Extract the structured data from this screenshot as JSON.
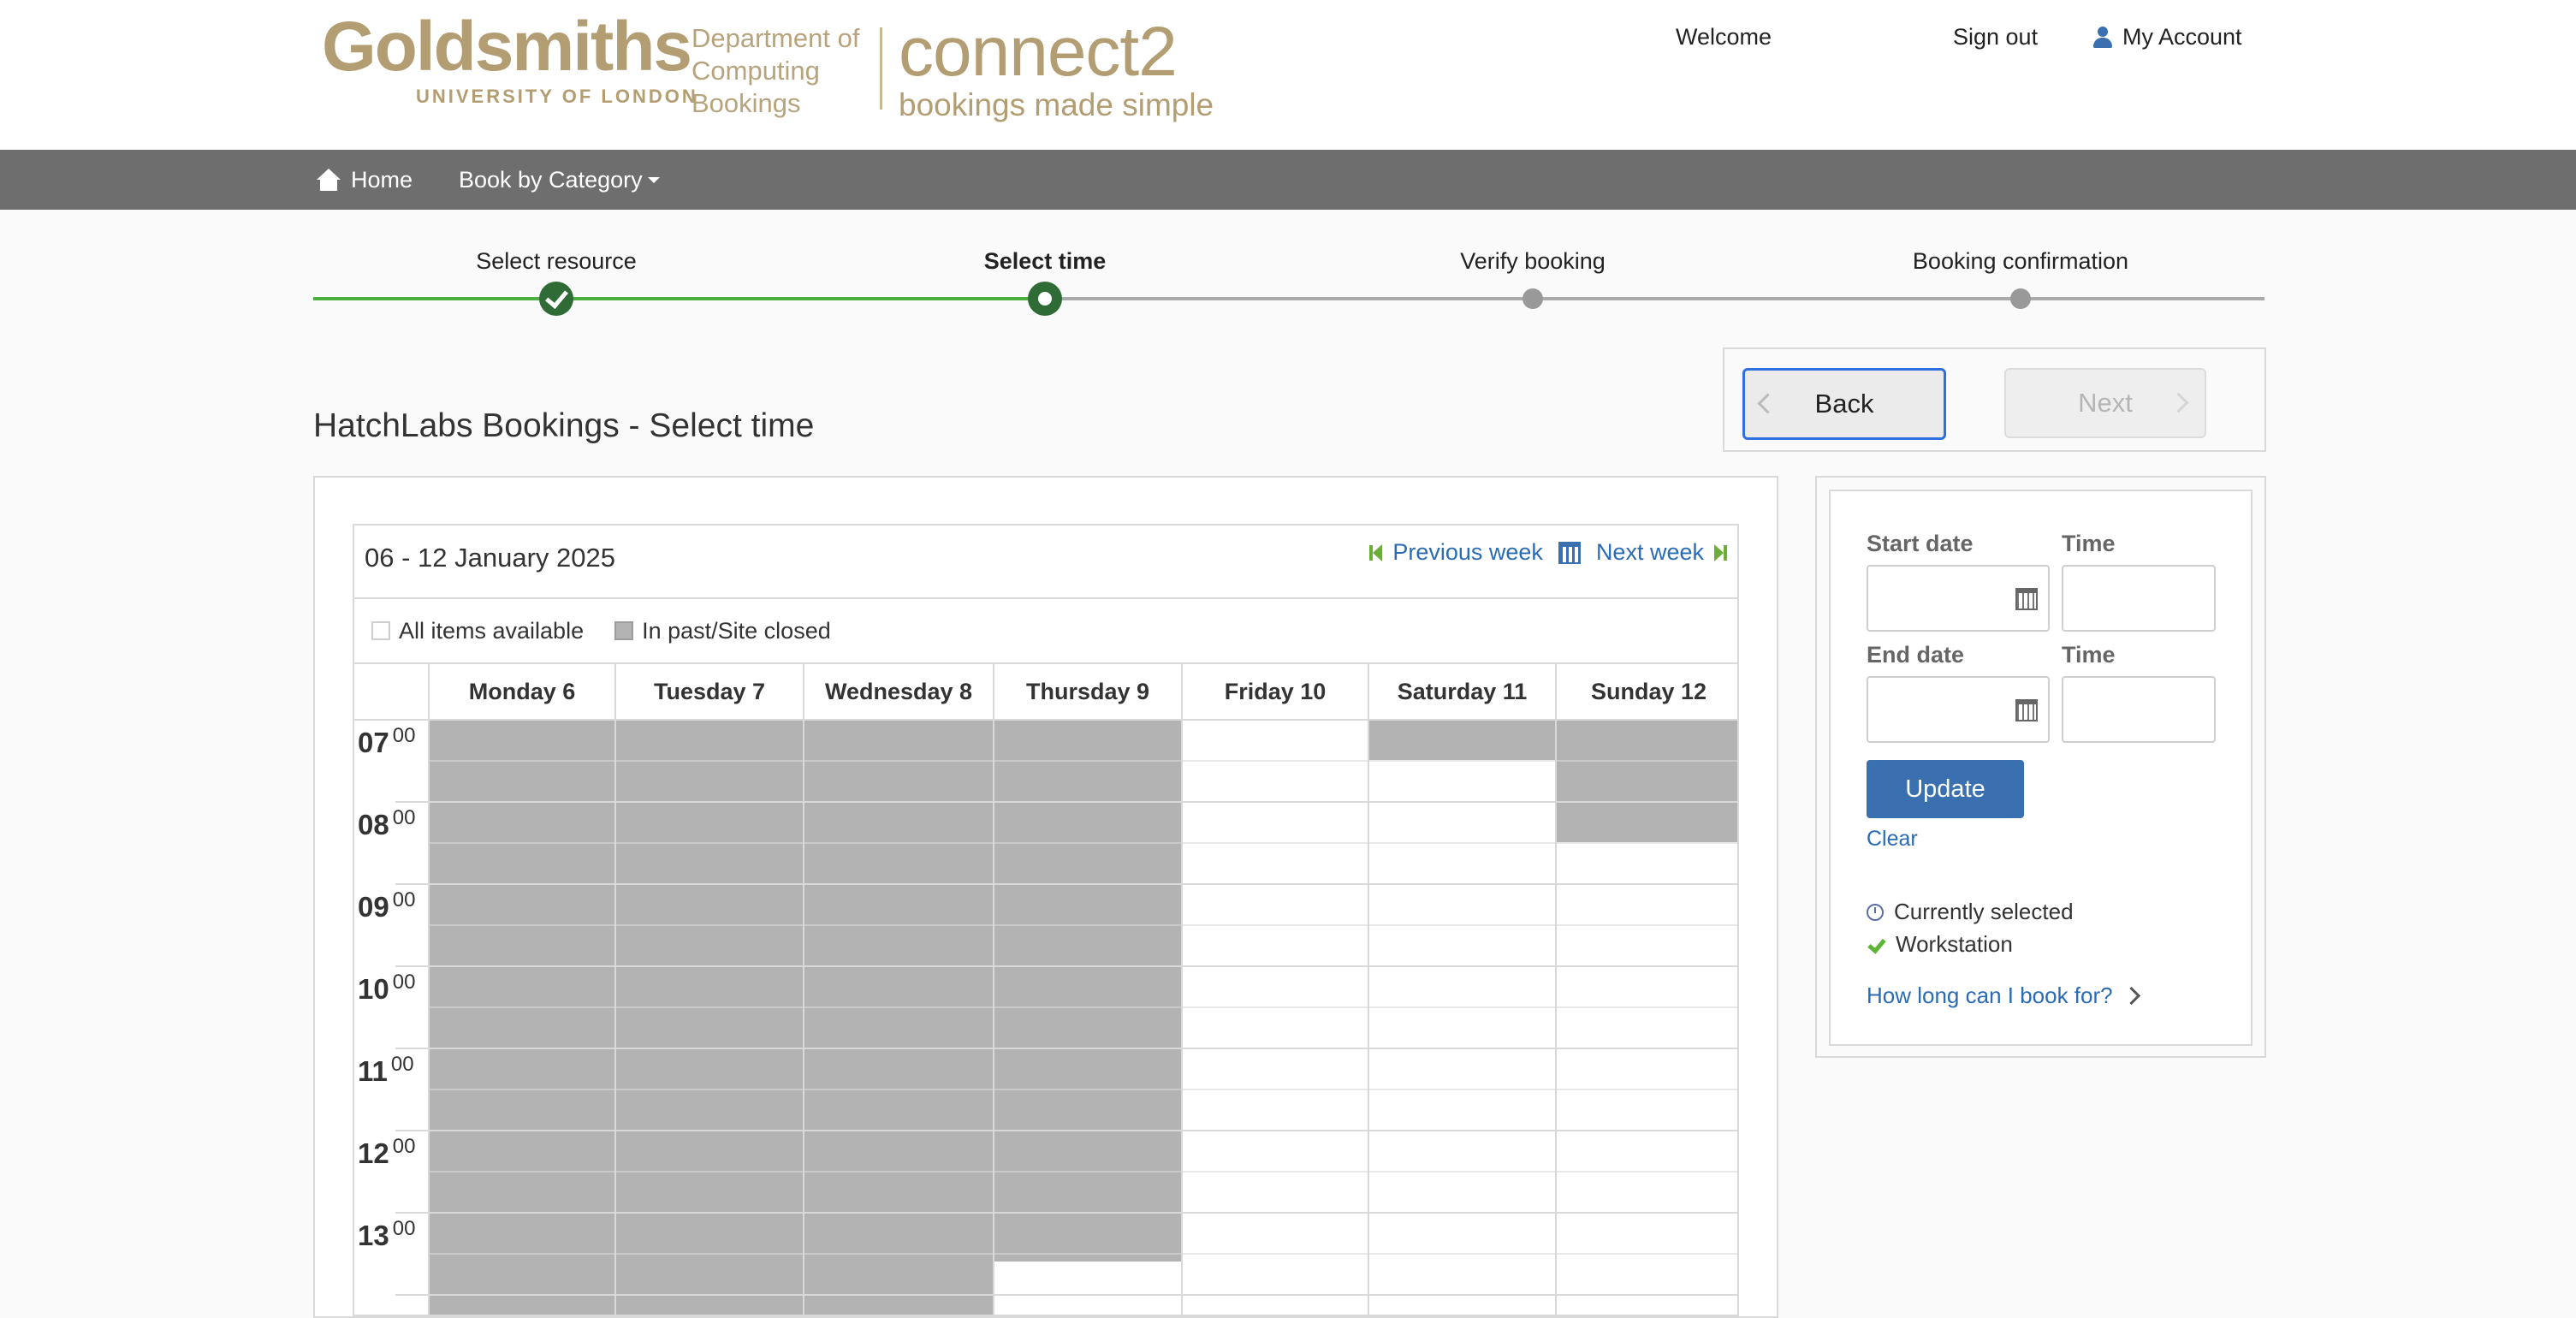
{
  "header": {
    "logo": {
      "name": "Goldsmiths",
      "sub": "UNIVERSITY OF LONDON"
    },
    "department": [
      "Department of",
      "Computing",
      "Bookings"
    ],
    "product": {
      "name": "connect2",
      "tagline": "bookings made simple"
    },
    "links": {
      "welcome": "Welcome",
      "sign_out": "Sign out",
      "my_account": "My Account"
    },
    "icons": {
      "account": "user-icon"
    }
  },
  "navbar": {
    "home": "Home",
    "book_by_category": "Book by Category",
    "icons": {
      "home": "home-icon",
      "dropdown": "caret-down-icon"
    }
  },
  "steps": [
    {
      "label": "Select resource",
      "state": "done"
    },
    {
      "label": "Select time",
      "state": "current"
    },
    {
      "label": "Verify booking",
      "state": "todo"
    },
    {
      "label": "Booking confirmation",
      "state": "todo"
    }
  ],
  "buttons": {
    "back": "Back",
    "next": "Next"
  },
  "page_title": "HatchLabs Bookings - Select time",
  "calendar": {
    "range": "06 - 12 January 2025",
    "prev_week": "Previous week",
    "next_week": "Next week",
    "legend": {
      "available": "All items available",
      "closed": "In past/Site closed"
    },
    "days": [
      "Monday 6",
      "Tuesday 7",
      "Wednesday 8",
      "Thursday 9",
      "Friday 10",
      "Saturday 11",
      "Sunday 12"
    ],
    "hours": [
      "07",
      "08",
      "09",
      "10",
      "11",
      "12",
      "13"
    ],
    "minutes": "00",
    "closed_until_hour": [
      14.5,
      14.5,
      14.5,
      13.6,
      7.0,
      7.5,
      8.5
    ]
  },
  "filter": {
    "start_date_label": "Start date",
    "start_time_label": "Time",
    "end_date_label": "End date",
    "end_time_label": "Time",
    "start_date_value": "",
    "start_time_value": "",
    "end_date_value": "",
    "end_time_value": "",
    "update": "Update",
    "clear": "Clear",
    "key_selected": "Currently selected",
    "key_workstation": "Workstation",
    "how_long": "How long can I book for?"
  },
  "colors": {
    "nav_bg": "#6e6e6e",
    "brand_gold": "#b39d72",
    "accent_blue": "#3a6fb0",
    "step_green": "#2e6b35",
    "closed_grey": "#b3b3b3"
  }
}
